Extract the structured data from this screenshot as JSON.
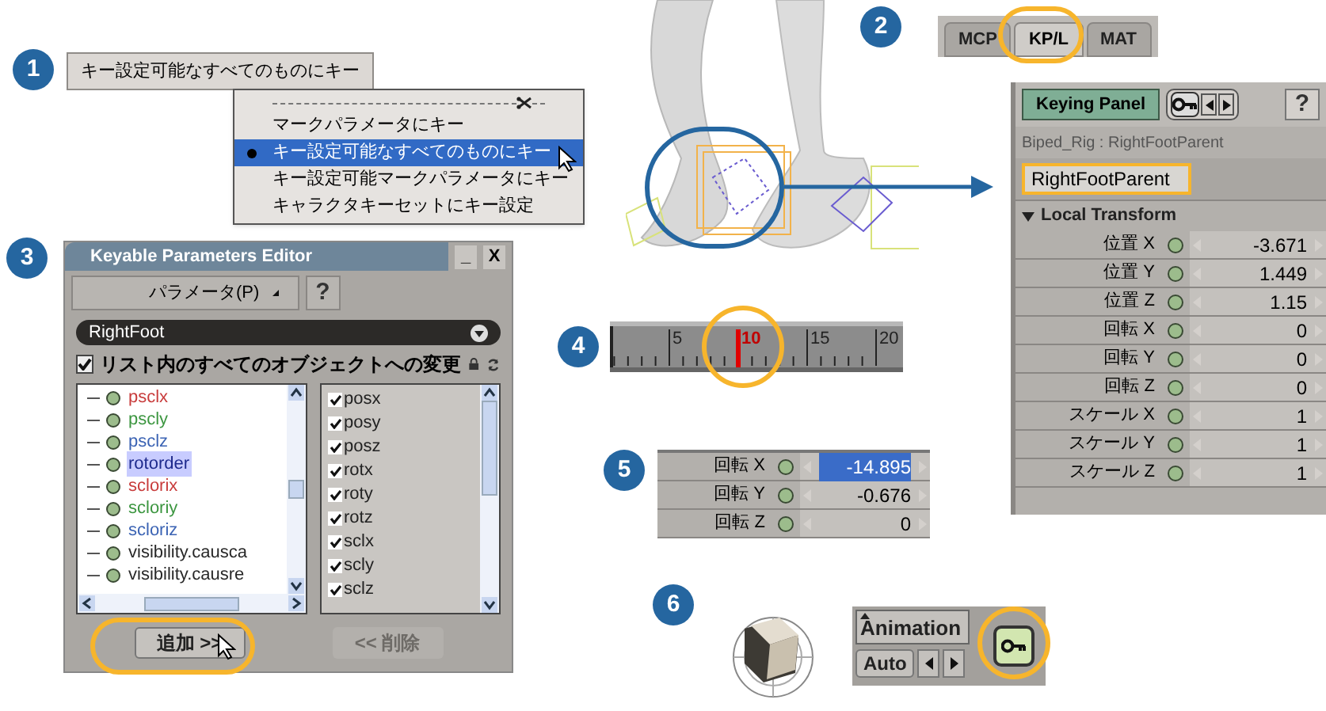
{
  "section_1": {
    "number": "1",
    "button": {
      "label": "キー設定可能なすべてのものにキー"
    },
    "menu": {
      "items": [
        {
          "label": "マークパラメータにキー",
          "selected": false
        },
        {
          "label": "キー設定可能なすべてのものにキー",
          "selected": true
        },
        {
          "label": "キー設定可能マークパラメータにキー",
          "selected": false
        },
        {
          "label": "キャラクタキーセットにキー設定",
          "selected": false
        }
      ]
    }
  },
  "section_2": {
    "number": "2",
    "tabs": [
      {
        "label": "MCP",
        "selected": false
      },
      {
        "label": "KP/L",
        "selected": true
      },
      {
        "label": "MAT",
        "selected": false
      }
    ],
    "keying_panel": {
      "title": "Keying Panel",
      "help": "?",
      "path": "Biped_Rig : RightFootParent",
      "name_field": "RightFootParent",
      "group": {
        "label": "Local Transform",
        "expanded": true
      },
      "rows": [
        {
          "label": "位置 X",
          "value": "-3.671"
        },
        {
          "label": "位置 Y",
          "value": "1.449"
        },
        {
          "label": "位置 Z",
          "value": "1.15"
        },
        {
          "label": "回転 X",
          "value": "0"
        },
        {
          "label": "回転 Y",
          "value": "0"
        },
        {
          "label": "回転 Z",
          "value": "0"
        },
        {
          "label": "スケール X",
          "value": "1"
        },
        {
          "label": "スケール Y",
          "value": "1"
        },
        {
          "label": "スケール Z",
          "value": "1"
        }
      ]
    }
  },
  "section_3": {
    "number": "3",
    "window": {
      "title": "Keyable Parameters Editor",
      "buttons": [
        "_",
        "X"
      ]
    },
    "menu": "パラメータ(P)",
    "help": "?",
    "dropdown": "RightFoot",
    "checkbox": {
      "label": "リスト内のすべてのオブジェクトへの変更",
      "checked": true
    },
    "tree_items": [
      {
        "label": "psclx",
        "color": "#c83c3c",
        "selected": false
      },
      {
        "label": "pscly",
        "color": "#3c9640",
        "selected": false
      },
      {
        "label": "psclz",
        "color": "#3c64b4",
        "selected": false
      },
      {
        "label": "rotorder",
        "color": "#1e2a8c",
        "selected": true
      },
      {
        "label": "sclorix",
        "color": "#c83c3c",
        "selected": false
      },
      {
        "label": "scloriy",
        "color": "#3c9640",
        "selected": false
      },
      {
        "label": "scloriz",
        "color": "#3c64b4",
        "selected": false
      },
      {
        "label": "visibility.causca",
        "color": "#282828",
        "selected": false
      },
      {
        "label": "visibility.causre",
        "color": "#282828",
        "selected": false
      }
    ],
    "keyed_items": [
      {
        "label": "posx",
        "checked": true
      },
      {
        "label": "posy",
        "checked": true
      },
      {
        "label": "posz",
        "checked": true
      },
      {
        "label": "rotx",
        "checked": true
      },
      {
        "label": "roty",
        "checked": true
      },
      {
        "label": "rotz",
        "checked": true
      },
      {
        "label": "sclx",
        "checked": true
      },
      {
        "label": "scly",
        "checked": true
      },
      {
        "label": "sclz",
        "checked": true
      }
    ],
    "buttons": [
      {
        "label": "追加 >>",
        "disabled": false
      },
      {
        "label": "<< 削除",
        "disabled": true
      }
    ]
  },
  "section_4": {
    "number": "4",
    "ticks": [
      {
        "label": "5",
        "current": false
      },
      {
        "label": "10",
        "current": true
      },
      {
        "label": "15",
        "current": false
      },
      {
        "label": "20",
        "current": false
      }
    ]
  },
  "section_5": {
    "number": "5",
    "rows": [
      {
        "label": "回転 X",
        "value": "-14.895",
        "selected": true
      },
      {
        "label": "回転 Y",
        "value": "-0.676",
        "selected": false
      },
      {
        "label": "回転 Z",
        "value": "0",
        "selected": false
      }
    ]
  },
  "section_6": {
    "number": "6",
    "menu": "Animation",
    "auto_button": "Auto"
  }
}
